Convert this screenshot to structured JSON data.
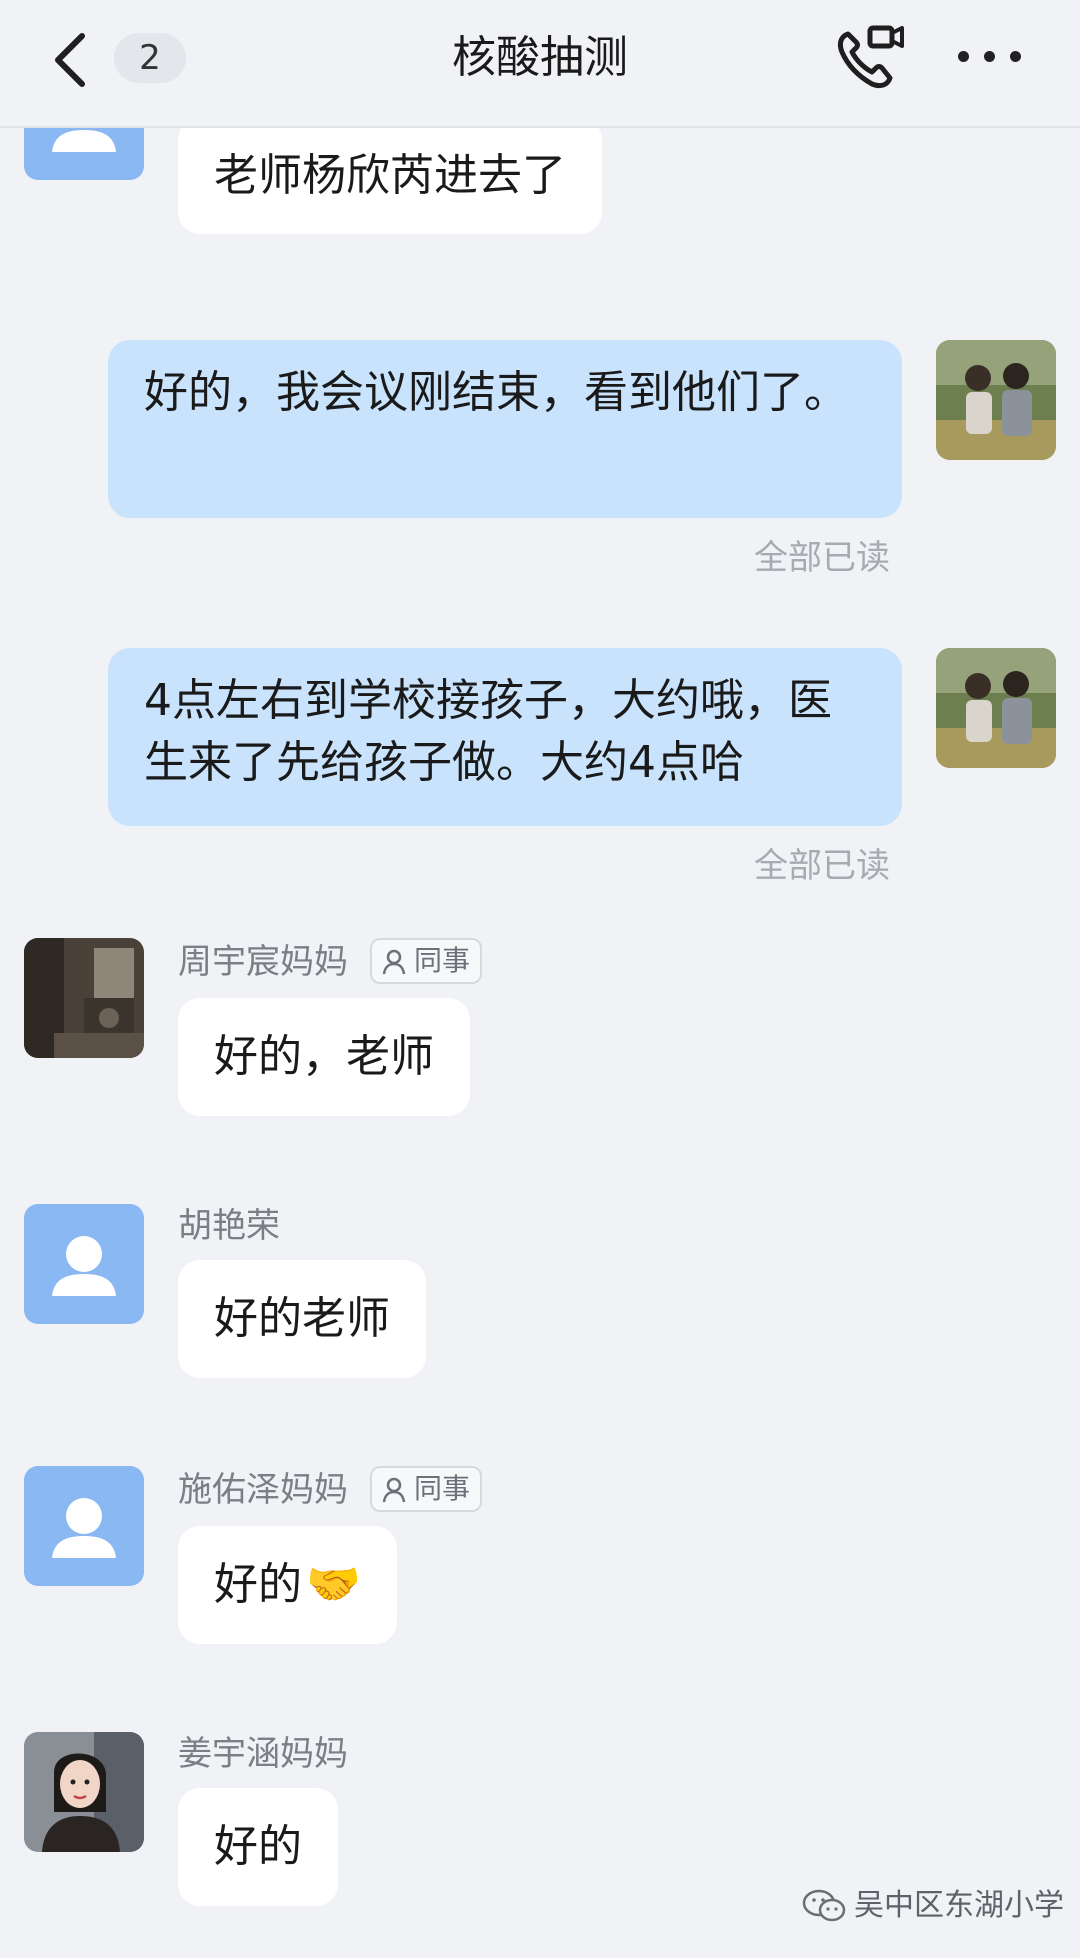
{
  "header": {
    "back_icon": "chevron-left-icon",
    "unread_count": "2",
    "title": "核酸抽测",
    "call_icon": "phone-video-icon",
    "more_icon": "more-horizontal-icon"
  },
  "messages": [
    {
      "direction": "in",
      "sender": "",
      "text": "老师杨欣芮进去了",
      "avatar": "default-person-icon"
    },
    {
      "direction": "out",
      "text": "好的，我会议刚结束，看到他们了。",
      "status": "全部已读",
      "avatar": "photo-children"
    },
    {
      "direction": "out",
      "text": "4点左右到学校接孩子，大约哦，医生来了先给孩子做。大约4点哈",
      "status": "全部已读",
      "avatar": "photo-children"
    },
    {
      "direction": "in",
      "sender": "周宇宸妈妈",
      "tag": "同事",
      "text": "好的，老师",
      "avatar": "photo-interior"
    },
    {
      "direction": "in",
      "sender": "胡艳荣",
      "text": "好的老师",
      "avatar": "default-person-icon"
    },
    {
      "direction": "in",
      "sender": "施佑泽妈妈",
      "tag": "同事",
      "text": "好的",
      "emoji": "🤝",
      "avatar": "default-person-icon"
    },
    {
      "direction": "in",
      "sender": "姜宇涵妈妈",
      "text": "好的",
      "avatar": "photo-girl"
    }
  ],
  "watermark": "吴中区东湖小学",
  "colors": {
    "background": "#f0f2f5",
    "incoming_bubble": "#ffffff",
    "outgoing_bubble": "#c9e3fd",
    "default_avatar": "#8ab8f2"
  }
}
